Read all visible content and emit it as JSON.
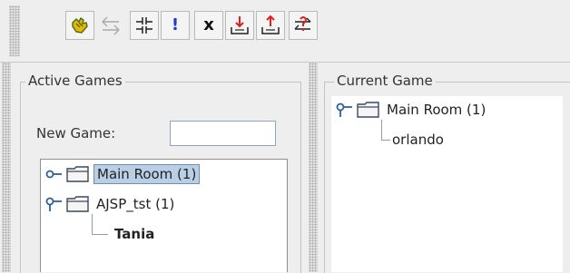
{
  "toolbar": {
    "buttons": [
      {
        "name": "join-game-button",
        "icon": "hand-icon"
      },
      {
        "name": "swap-button",
        "icon": "swap-arrows-icon"
      },
      {
        "name": "split-button",
        "icon": "split-icon"
      },
      {
        "name": "alert-button",
        "icon": "exclamation-icon",
        "glyph": "!"
      },
      {
        "name": "close-game-button",
        "icon": "x-icon",
        "glyph": "x"
      },
      {
        "name": "download-button",
        "icon": "download-tray-icon"
      },
      {
        "name": "upload-button",
        "icon": "upload-tray-icon"
      },
      {
        "name": "sync-button",
        "icon": "sync-question-icon"
      }
    ]
  },
  "active_games": {
    "title": "Active Games",
    "new_game_label": "New Game:",
    "new_game_value": "",
    "tree": [
      {
        "label": "Main Room (1)",
        "selected": true
      },
      {
        "label": "AJSP_tst (1)",
        "selected": false,
        "children": [
          "Tania"
        ]
      }
    ]
  },
  "current_game": {
    "title": "Current Game",
    "room": "Main Room (1)",
    "players": [
      "orlando"
    ]
  },
  "colors": {
    "background": "#eeeeee",
    "selection": "#b8cfe5",
    "alert_blue": "#1a3bd6",
    "arrow_red": "#e0201b"
  }
}
